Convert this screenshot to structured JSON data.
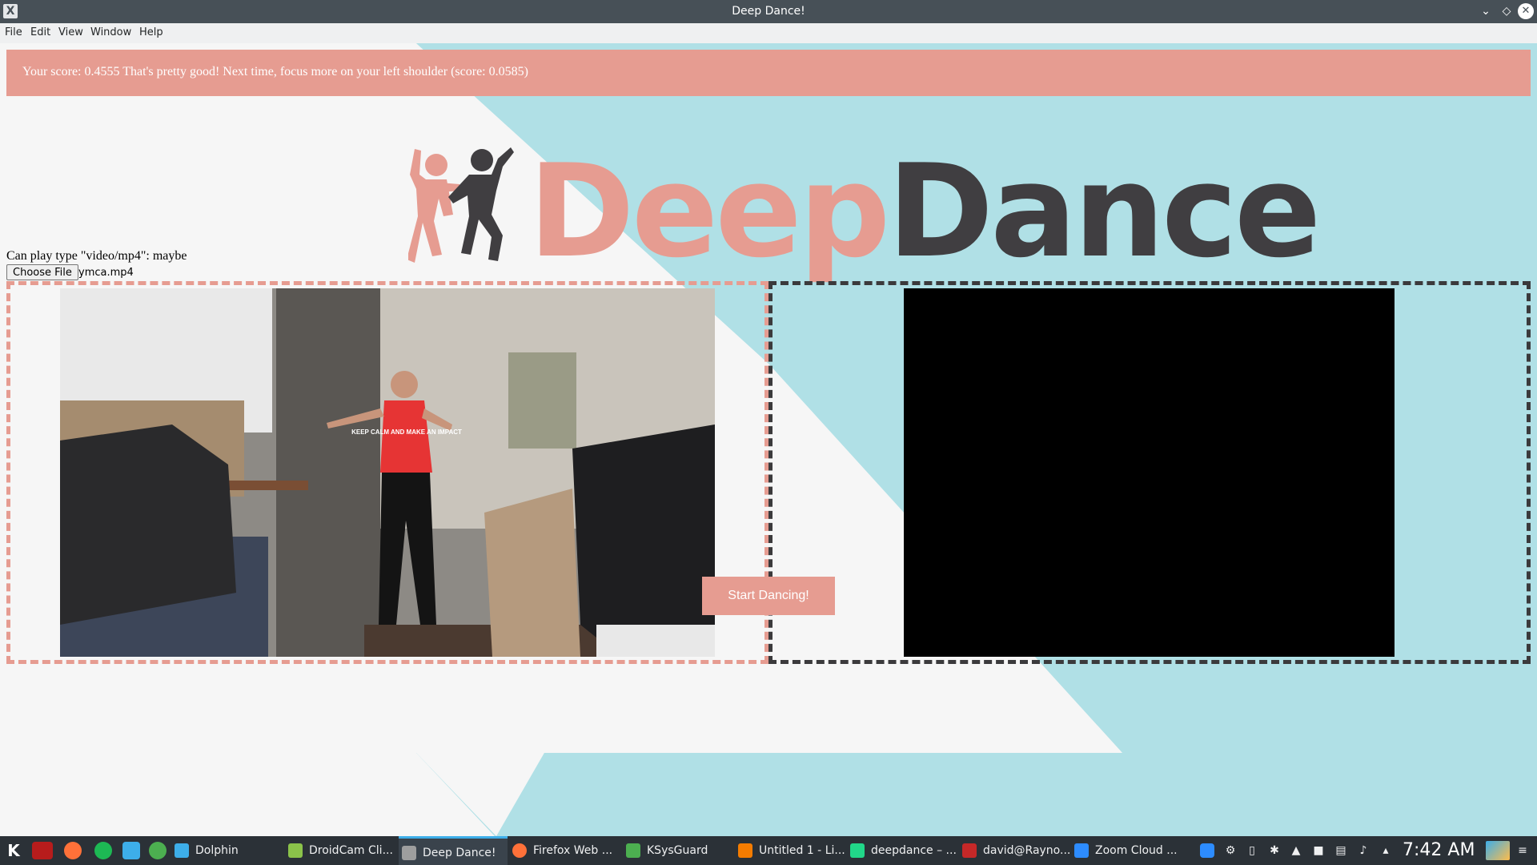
{
  "window": {
    "title": "Deep Dance!"
  },
  "menu": [
    "File",
    "Edit",
    "View",
    "Window",
    "Help"
  ],
  "score_message": "Your score: 0.4555 That's pretty good! Next time, focus more on your left shoulder (score: 0.0585)",
  "logo": {
    "part1": "Deep",
    "part2": "Dance"
  },
  "can_play_text": "Can play type \"video/mp4\": maybe",
  "file_input": {
    "button_label": "Choose File",
    "file_name": "ymca.mp4"
  },
  "start_button": "Start Dancing!",
  "shirt_text": "KEEP CALM AND MAKE AN IMPACT",
  "taskbar": {
    "tasks": [
      {
        "label": "Dolphin",
        "color": "#3daee9"
      },
      {
        "label": "DroidCam Cli...",
        "color": "#8bc34a"
      },
      {
        "label": "Deep Dance!",
        "color": "#9e9e9e"
      },
      {
        "label": "Firefox Web ...",
        "color": "#ff7139"
      },
      {
        "label": "KSysGuard",
        "color": "#4caf50"
      },
      {
        "label": "Untitled 1 - Li...",
        "color": "#f57c00"
      },
      {
        "label": "deepdance – ...",
        "color": "#21d789"
      },
      {
        "label": "david@Rayno...",
        "color": "#c62828"
      },
      {
        "label": "Zoom Cloud ...",
        "color": "#2d8cff"
      }
    ],
    "clock": "7:42 AM"
  },
  "colors": {
    "accent": "#e69c91",
    "teal": "#b0e0e6",
    "dark": "#403e41"
  }
}
